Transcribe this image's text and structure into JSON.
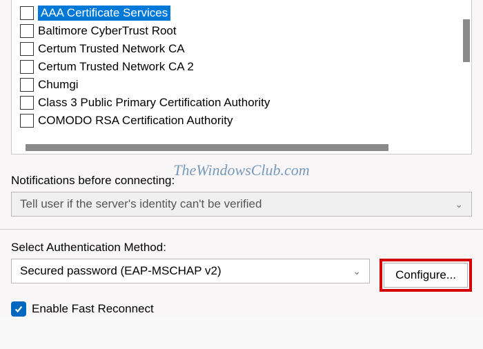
{
  "certificates": [
    {
      "label": "AAA Certificate Services",
      "selected": true,
      "checked": false
    },
    {
      "label": "Baltimore CyberTrust Root",
      "selected": false,
      "checked": false
    },
    {
      "label": "Certum Trusted Network CA",
      "selected": false,
      "checked": false
    },
    {
      "label": "Certum Trusted Network CA 2",
      "selected": false,
      "checked": false
    },
    {
      "label": "Chumgi",
      "selected": false,
      "checked": false
    },
    {
      "label": "Class 3 Public Primary Certification Authority",
      "selected": false,
      "checked": false
    },
    {
      "label": "COMODO RSA Certification Authority",
      "selected": false,
      "checked": false
    }
  ],
  "notifications": {
    "label": "Notifications before connecting:",
    "selected": "Tell user if the server's identity can't be verified"
  },
  "auth": {
    "label": "Select Authentication Method:",
    "selected": "Secured password (EAP-MSCHAP v2)",
    "configure_label": "Configure..."
  },
  "fast_reconnect": {
    "label": "Enable Fast Reconnect",
    "checked": true
  },
  "watermark": "TheWindowsClub.com"
}
